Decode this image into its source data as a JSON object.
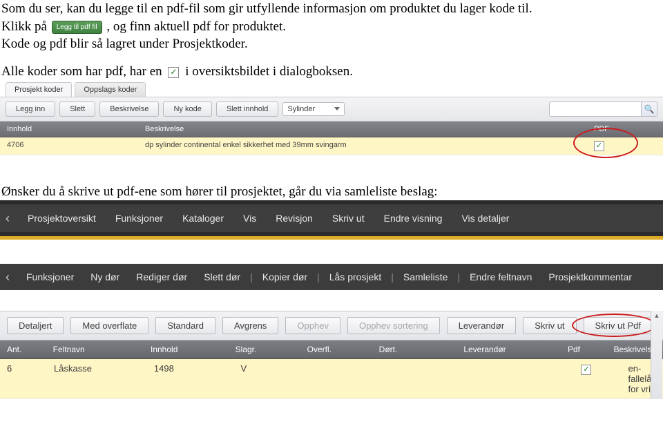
{
  "doc": {
    "p1": "Som du ser, kan du legge til en pdf-fil som gir utfyllende informasjon om produktet du lager kode til.",
    "p2a": "Klikk på ",
    "chip_label": "Legg til pdf fil",
    "p2b": ", og finn aktuell pdf for produktet.",
    "p3": "Kode og pdf blir så lagret under Prosjektkoder.",
    "p4a": "Alle koder som har pdf, har en ",
    "p4b": " i oversiktsbildet i dialogboksen.",
    "p5": "Ønsker du å skrive ut pdf-ene som hører til prosjektet, går du via samleliste beslag:"
  },
  "app1": {
    "tabs": [
      {
        "label": "Prosjekt koder",
        "active": true
      },
      {
        "label": "Oppslags koder",
        "active": false
      }
    ],
    "toolbar": {
      "legg_inn": "Legg inn",
      "slett": "Slett",
      "beskrivelse": "Beskrivelse",
      "ny_kode": "Ny kode",
      "slett_innhold": "Slett innhold",
      "select_label": "Sylinder",
      "search_placeholder": ""
    },
    "headers": {
      "innhold": "Innhold",
      "beskrivelse": "Beskrivelse",
      "pdf": "PDF"
    },
    "row": {
      "innhold": "4706",
      "beskrivelse": "dp sylinder continental enkel sikkerhet med 39mm svingarm",
      "pdf_checked": "✓"
    }
  },
  "menu1": {
    "items": [
      "Prosjektoversikt",
      "Funksjoner",
      "Kataloger",
      "Vis",
      "Revisjon",
      "Skriv ut",
      "Endre visning",
      "Vis detaljer"
    ]
  },
  "menu2": {
    "items": [
      "Funksjoner",
      "Ny dør",
      "Rediger dør",
      "Slett dør",
      "|",
      "Kopier dør",
      "|",
      "Lås prosjekt",
      "|",
      "Samleliste",
      "|",
      "Endre feltnavn",
      "Prosjektkommentar"
    ]
  },
  "app3": {
    "toolbar": {
      "detaljert": "Detaljert",
      "med_overflate": "Med overflate",
      "standard": "Standard",
      "avgrens": "Avgrens",
      "opphev": "Opphev",
      "opphev_sort": "Opphev sortering",
      "leverandor": "Leverandør",
      "skriv_ut": "Skriv ut",
      "skriv_ut_pdf": "Skriv ut Pdf"
    },
    "headers": {
      "ant": "Ant.",
      "feltnavn": "Feltnavn",
      "innhold": "Innhold",
      "slagr": "Slagr.",
      "overfl": "Overfl.",
      "dort": "Dørt.",
      "leverandor": "Leverandør",
      "pdf": "Pdf",
      "beskrivelse": "Beskrivelse"
    },
    "row": {
      "ant": "6",
      "feltnavn": "Låskasse",
      "innhold": "1498",
      "slagr": "V",
      "overfl": "",
      "dort": "",
      "leverandor": "",
      "pdf_checked": "✓",
      "beskrivelse": "en-fallelås for vrid"
    }
  }
}
